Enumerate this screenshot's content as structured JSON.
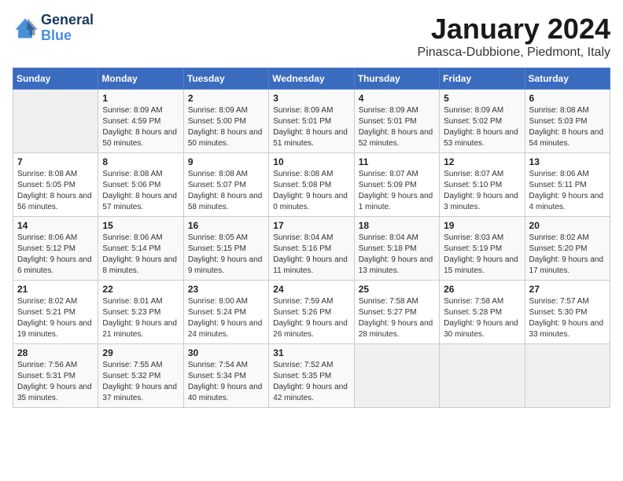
{
  "logo": {
    "line1": "General",
    "line2": "Blue"
  },
  "title": "January 2024",
  "location": "Pinasca-Dubbione, Piedmont, Italy",
  "headers": [
    "Sunday",
    "Monday",
    "Tuesday",
    "Wednesday",
    "Thursday",
    "Friday",
    "Saturday"
  ],
  "weeks": [
    [
      {
        "day": "",
        "sunrise": "",
        "sunset": "",
        "daylight": ""
      },
      {
        "day": "1",
        "sunrise": "Sunrise: 8:09 AM",
        "sunset": "Sunset: 4:59 PM",
        "daylight": "Daylight: 8 hours and 50 minutes."
      },
      {
        "day": "2",
        "sunrise": "Sunrise: 8:09 AM",
        "sunset": "Sunset: 5:00 PM",
        "daylight": "Daylight: 8 hours and 50 minutes."
      },
      {
        "day": "3",
        "sunrise": "Sunrise: 8:09 AM",
        "sunset": "Sunset: 5:01 PM",
        "daylight": "Daylight: 8 hours and 51 minutes."
      },
      {
        "day": "4",
        "sunrise": "Sunrise: 8:09 AM",
        "sunset": "Sunset: 5:01 PM",
        "daylight": "Daylight: 8 hours and 52 minutes."
      },
      {
        "day": "5",
        "sunrise": "Sunrise: 8:09 AM",
        "sunset": "Sunset: 5:02 PM",
        "daylight": "Daylight: 8 hours and 53 minutes."
      },
      {
        "day": "6",
        "sunrise": "Sunrise: 8:08 AM",
        "sunset": "Sunset: 5:03 PM",
        "daylight": "Daylight: 8 hours and 54 minutes."
      }
    ],
    [
      {
        "day": "7",
        "sunrise": "Sunrise: 8:08 AM",
        "sunset": "Sunset: 5:05 PM",
        "daylight": "Daylight: 8 hours and 56 minutes."
      },
      {
        "day": "8",
        "sunrise": "Sunrise: 8:08 AM",
        "sunset": "Sunset: 5:06 PM",
        "daylight": "Daylight: 8 hours and 57 minutes."
      },
      {
        "day": "9",
        "sunrise": "Sunrise: 8:08 AM",
        "sunset": "Sunset: 5:07 PM",
        "daylight": "Daylight: 8 hours and 58 minutes."
      },
      {
        "day": "10",
        "sunrise": "Sunrise: 8:08 AM",
        "sunset": "Sunset: 5:08 PM",
        "daylight": "Daylight: 9 hours and 0 minutes."
      },
      {
        "day": "11",
        "sunrise": "Sunrise: 8:07 AM",
        "sunset": "Sunset: 5:09 PM",
        "daylight": "Daylight: 9 hours and 1 minute."
      },
      {
        "day": "12",
        "sunrise": "Sunrise: 8:07 AM",
        "sunset": "Sunset: 5:10 PM",
        "daylight": "Daylight: 9 hours and 3 minutes."
      },
      {
        "day": "13",
        "sunrise": "Sunrise: 8:06 AM",
        "sunset": "Sunset: 5:11 PM",
        "daylight": "Daylight: 9 hours and 4 minutes."
      }
    ],
    [
      {
        "day": "14",
        "sunrise": "Sunrise: 8:06 AM",
        "sunset": "Sunset: 5:12 PM",
        "daylight": "Daylight: 9 hours and 6 minutes."
      },
      {
        "day": "15",
        "sunrise": "Sunrise: 8:06 AM",
        "sunset": "Sunset: 5:14 PM",
        "daylight": "Daylight: 9 hours and 8 minutes."
      },
      {
        "day": "16",
        "sunrise": "Sunrise: 8:05 AM",
        "sunset": "Sunset: 5:15 PM",
        "daylight": "Daylight: 9 hours and 9 minutes."
      },
      {
        "day": "17",
        "sunrise": "Sunrise: 8:04 AM",
        "sunset": "Sunset: 5:16 PM",
        "daylight": "Daylight: 9 hours and 11 minutes."
      },
      {
        "day": "18",
        "sunrise": "Sunrise: 8:04 AM",
        "sunset": "Sunset: 5:18 PM",
        "daylight": "Daylight: 9 hours and 13 minutes."
      },
      {
        "day": "19",
        "sunrise": "Sunrise: 8:03 AM",
        "sunset": "Sunset: 5:19 PM",
        "daylight": "Daylight: 9 hours and 15 minutes."
      },
      {
        "day": "20",
        "sunrise": "Sunrise: 8:02 AM",
        "sunset": "Sunset: 5:20 PM",
        "daylight": "Daylight: 9 hours and 17 minutes."
      }
    ],
    [
      {
        "day": "21",
        "sunrise": "Sunrise: 8:02 AM",
        "sunset": "Sunset: 5:21 PM",
        "daylight": "Daylight: 9 hours and 19 minutes."
      },
      {
        "day": "22",
        "sunrise": "Sunrise: 8:01 AM",
        "sunset": "Sunset: 5:23 PM",
        "daylight": "Daylight: 9 hours and 21 minutes."
      },
      {
        "day": "23",
        "sunrise": "Sunrise: 8:00 AM",
        "sunset": "Sunset: 5:24 PM",
        "daylight": "Daylight: 9 hours and 24 minutes."
      },
      {
        "day": "24",
        "sunrise": "Sunrise: 7:59 AM",
        "sunset": "Sunset: 5:26 PM",
        "daylight": "Daylight: 9 hours and 26 minutes."
      },
      {
        "day": "25",
        "sunrise": "Sunrise: 7:58 AM",
        "sunset": "Sunset: 5:27 PM",
        "daylight": "Daylight: 9 hours and 28 minutes."
      },
      {
        "day": "26",
        "sunrise": "Sunrise: 7:58 AM",
        "sunset": "Sunset: 5:28 PM",
        "daylight": "Daylight: 9 hours and 30 minutes."
      },
      {
        "day": "27",
        "sunrise": "Sunrise: 7:57 AM",
        "sunset": "Sunset: 5:30 PM",
        "daylight": "Daylight: 9 hours and 33 minutes."
      }
    ],
    [
      {
        "day": "28",
        "sunrise": "Sunrise: 7:56 AM",
        "sunset": "Sunset: 5:31 PM",
        "daylight": "Daylight: 9 hours and 35 minutes."
      },
      {
        "day": "29",
        "sunrise": "Sunrise: 7:55 AM",
        "sunset": "Sunset: 5:32 PM",
        "daylight": "Daylight: 9 hours and 37 minutes."
      },
      {
        "day": "30",
        "sunrise": "Sunrise: 7:54 AM",
        "sunset": "Sunset: 5:34 PM",
        "daylight": "Daylight: 9 hours and 40 minutes."
      },
      {
        "day": "31",
        "sunrise": "Sunrise: 7:52 AM",
        "sunset": "Sunset: 5:35 PM",
        "daylight": "Daylight: 9 hours and 42 minutes."
      },
      {
        "day": "",
        "sunrise": "",
        "sunset": "",
        "daylight": ""
      },
      {
        "day": "",
        "sunrise": "",
        "sunset": "",
        "daylight": ""
      },
      {
        "day": "",
        "sunrise": "",
        "sunset": "",
        "daylight": ""
      }
    ]
  ]
}
